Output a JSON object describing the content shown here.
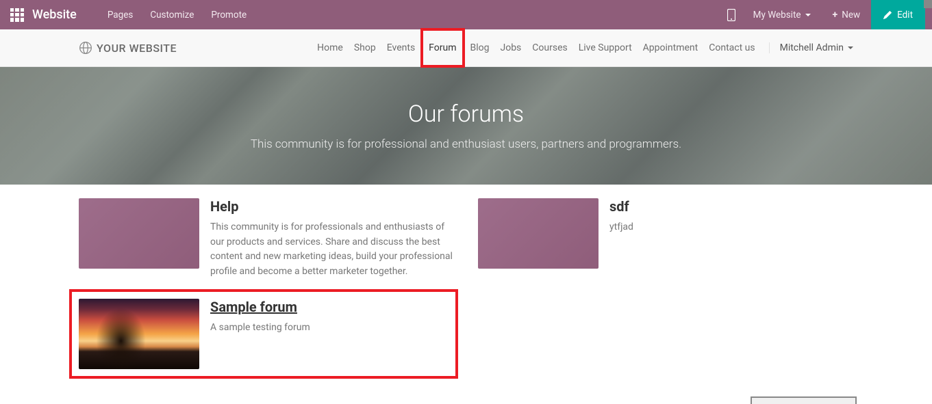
{
  "admin": {
    "app_title": "Website",
    "menu": [
      "Pages",
      "Customize",
      "Promote"
    ],
    "site_selector": "My Website",
    "new_label": "New",
    "edit_label": "Edit"
  },
  "nav": {
    "logo_text": "YOUR WEBSITE",
    "links": [
      "Home",
      "Shop",
      "Events",
      "Forum",
      "Blog",
      "Jobs",
      "Courses",
      "Live Support",
      "Appointment",
      "Contact us"
    ],
    "active_index": 3,
    "user_name": "Mitchell Admin"
  },
  "hero": {
    "title": "Our forums",
    "subtitle": "This community is for professional and enthusiast users, partners and programmers."
  },
  "forums": [
    {
      "title": "Help",
      "desc": "This community is for professionals and enthusiasts of our products and services. Share and discuss the best content and new marketing ideas, build your professional profile and become a better marketer together.",
      "thumb": "purple",
      "highlighted": false,
      "underline": false,
      "column": "left"
    },
    {
      "title": "Sample forum",
      "desc": "A sample testing forum",
      "thumb": "sunset",
      "highlighted": true,
      "underline": true,
      "column": "left"
    },
    {
      "title": "sdf",
      "desc": "ytfjad",
      "thumb": "purple",
      "highlighted": false,
      "underline": false,
      "column": "right"
    }
  ]
}
